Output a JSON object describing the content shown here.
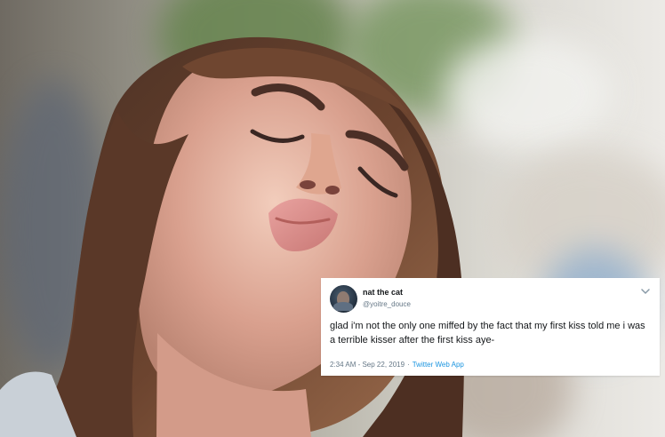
{
  "tweet": {
    "name": "nat the cat",
    "handle": "@yoitre_douce",
    "text": "glad i'm not the only one miffed by the fact that my first kiss told me i was a terrible kisser after the first kiss aye-",
    "timestamp": "2:34 AM - Sep 22, 2019",
    "separator": "·",
    "source": "Twitter Web App"
  },
  "colors": {
    "primary_text": "#14171a",
    "secondary_text": "#657786",
    "link": "#1b95e0",
    "card_background": "#ffffff"
  },
  "icons": {
    "menu": "chevron-down-icon"
  }
}
